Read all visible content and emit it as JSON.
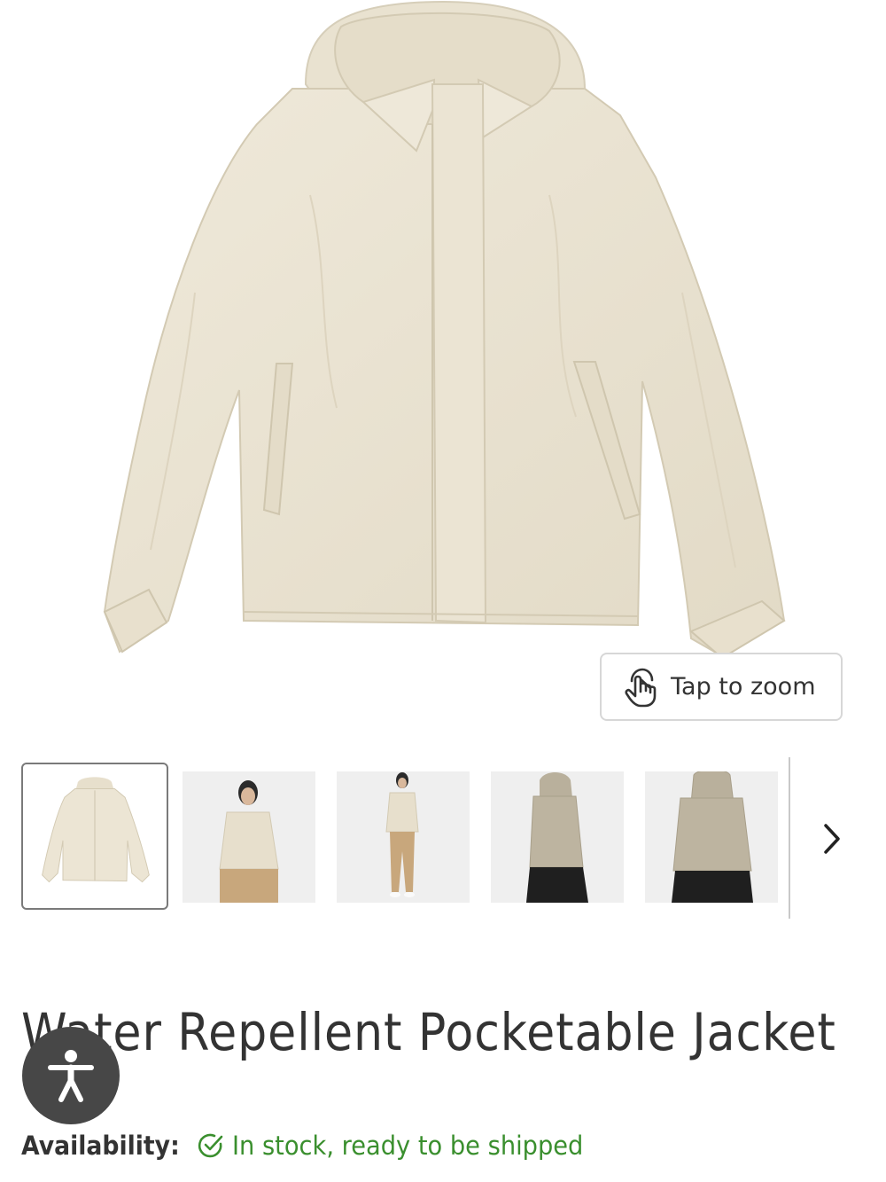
{
  "product": {
    "title": "Water Repellent Pocketable Jacket",
    "main_image_alt": "jacket-front-view",
    "zoom_label": "Tap to zoom",
    "availability_label": "Availability:",
    "availability_status": "In stock, ready to be shipped",
    "status_color": "#3a8f2e"
  },
  "gallery": {
    "selected_index": 0,
    "thumbnails": [
      {
        "name": "jacket-flat-front"
      },
      {
        "name": "model-front-waist-up"
      },
      {
        "name": "model-full-body"
      },
      {
        "name": "model-side-view"
      },
      {
        "name": "model-back-view"
      }
    ],
    "next_icon": "chevron-right-icon"
  },
  "icons": {
    "zoom": "tap-gesture-icon",
    "accessibility": "accessibility-person-icon",
    "availability": "check-circle-icon"
  }
}
